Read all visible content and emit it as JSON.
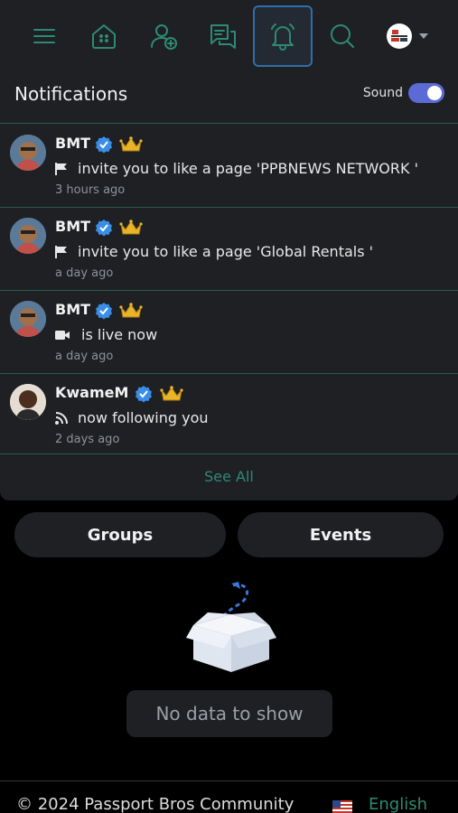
{
  "nav": {
    "items": [
      {
        "icon": "menu-icon"
      },
      {
        "icon": "home-icon"
      },
      {
        "icon": "add-user-icon"
      },
      {
        "icon": "messages-icon"
      },
      {
        "icon": "bell-icon",
        "active": true
      },
      {
        "icon": "search-icon"
      }
    ],
    "accent": "#2e8a72",
    "active_border": "#2f6ea8"
  },
  "notifications": {
    "title": "Notifications",
    "sound_label": "Sound",
    "sound_on": true,
    "items": [
      {
        "name": "BMT",
        "icon": "flag-icon",
        "text": "invite you to like a page 'PPBNEWS NETWORK '",
        "time": "3 hours ago"
      },
      {
        "name": "BMT",
        "icon": "flag-icon",
        "text": "invite you to like a page 'Global Rentals '",
        "time": "a day ago"
      },
      {
        "name": "BMT",
        "icon": "video-icon",
        "text": "is live now",
        "time": "a day ago"
      },
      {
        "name": "KwameM",
        "icon": "rss-icon",
        "text": "now following you",
        "time": "2 days ago"
      }
    ],
    "see_all": "See All"
  },
  "tabs": {
    "groups": "Groups",
    "events": "Events"
  },
  "empty_state": "No data to show",
  "footer": {
    "copyright": "© 2024 Passport Bros Community",
    "language": "English"
  },
  "colors": {
    "panel": "#1e2024",
    "background": "#000000",
    "toggle": "#5b6bd6",
    "verified": "#3b8ee8",
    "crown": "#e9b528"
  }
}
